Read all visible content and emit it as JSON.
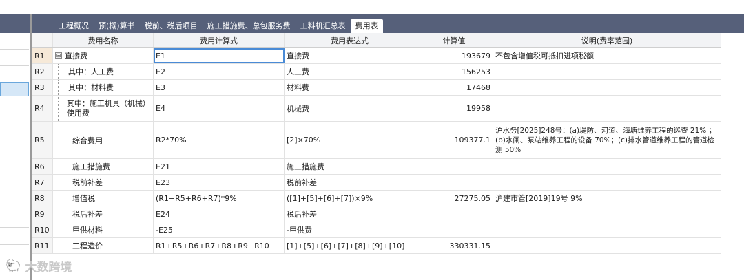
{
  "tabs": [
    {
      "label": "工程概况",
      "active": false
    },
    {
      "label": "预(概)算书",
      "active": false
    },
    {
      "label": "税前、税后项目",
      "active": false
    },
    {
      "label": "施工措施费、总包服务费",
      "active": false
    },
    {
      "label": "工料机汇总表",
      "active": false
    },
    {
      "label": "费用表",
      "active": true
    }
  ],
  "columns": [
    "费用名称",
    "费用计算式",
    "费用表达式",
    "计算值",
    "说明(费率范围)"
  ],
  "rows": [
    {
      "id": "R1",
      "name": "直接费",
      "formula": "E1",
      "expr": "直接费",
      "value": "193679",
      "note": "不包含增值税可抵扣进项税额"
    },
    {
      "id": "R2",
      "name": "其中：人工费",
      "formula": "E2",
      "expr": "人工费",
      "value": "156253",
      "note": ""
    },
    {
      "id": "R3",
      "name": "其中：材料费",
      "formula": "E3",
      "expr": "材料费",
      "value": "17468",
      "note": ""
    },
    {
      "id": "R4",
      "name": "其中：施工机具（机械）使用费",
      "formula": "E4",
      "expr": "机械费",
      "value": "19958",
      "note": ""
    },
    {
      "id": "R5",
      "name": "综合费用",
      "formula": "R2*70%",
      "expr": "[2]×70%",
      "value": "109377.1",
      "note": "沪水务[2025]248号：(a)堤防、河道、海塘维养工程的巡查 21% ；(b)水闸、泵站维养工程的设备 70%；(c)排水管道维养工程的管道检测 50%"
    },
    {
      "id": "R6",
      "name": "施工措施费",
      "formula": "E21",
      "expr": "施工措施费",
      "value": "",
      "note": ""
    },
    {
      "id": "R7",
      "name": "税前补差",
      "formula": "E23",
      "expr": "税前补差",
      "value": "",
      "note": ""
    },
    {
      "id": "R8",
      "name": "增值税",
      "formula": "(R1+R5+R6+R7)*9%",
      "expr": "([1]+[5]+[6]+[7])×9%",
      "value": "27275.05",
      "note": "沪建市管[2019]19号 9%"
    },
    {
      "id": "R9",
      "name": "税后补差",
      "formula": "E24",
      "expr": "税后补差",
      "value": "",
      "note": ""
    },
    {
      "id": "R10",
      "name": "甲供材料",
      "formula": "-E25",
      "expr": "-甲供费",
      "value": "",
      "note": ""
    },
    {
      "id": "R11",
      "name": "工程造价",
      "formula": "R1+R5+R6+R7+R8+R9+R10",
      "expr": "[1]+[5]+[6]+[7]+[8]+[9]+[10]",
      "value": "330331.15",
      "note": ""
    }
  ],
  "tree_toggle": "⊟",
  "watermark": {
    "icon": "🐑",
    "text": "大数跨境"
  }
}
